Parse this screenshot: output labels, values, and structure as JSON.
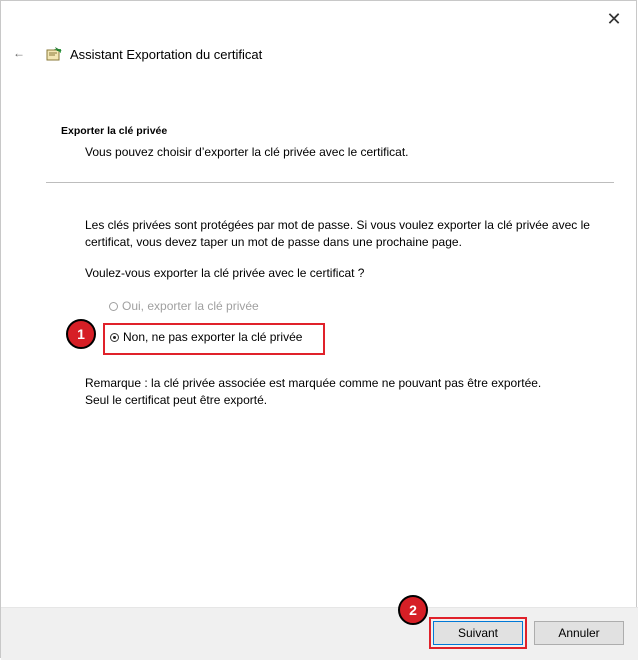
{
  "window": {
    "close_glyph": "✕",
    "back_glyph": "←",
    "title": "Assistant Exportation du certificat"
  },
  "section": {
    "heading": "Exporter la clé privée",
    "subtitle": "Vous pouvez choisir d’exporter la clé privée avec le certificat."
  },
  "body": {
    "paragraph_1": "Les clés privées sont protégées par mot de passe. Si vous voulez exporter la clé privée avec le certificat, vous devez taper un mot de passe dans une prochaine page.",
    "question": "Voulez-vous exporter la clé privée avec le certificat ?",
    "options": [
      {
        "label": "Oui, exporter la clé privée",
        "selected": false,
        "enabled": false
      },
      {
        "label": "Non, ne pas exporter la clé privée",
        "selected": true,
        "enabled": true
      }
    ],
    "remark_line1": "Remarque : la clé privée associée est marquée comme ne pouvant pas être exportée.",
    "remark_line2": "Seul le certificat peut être exporté."
  },
  "callouts": {
    "step1": "1",
    "step2": "2"
  },
  "footer": {
    "next_label": "Suivant",
    "cancel_label": "Annuler"
  },
  "colors": {
    "highlight": "#e0212a",
    "callout": "#d61f26",
    "footer_bg": "#f0f0f0",
    "focus_border": "#0078d7"
  }
}
